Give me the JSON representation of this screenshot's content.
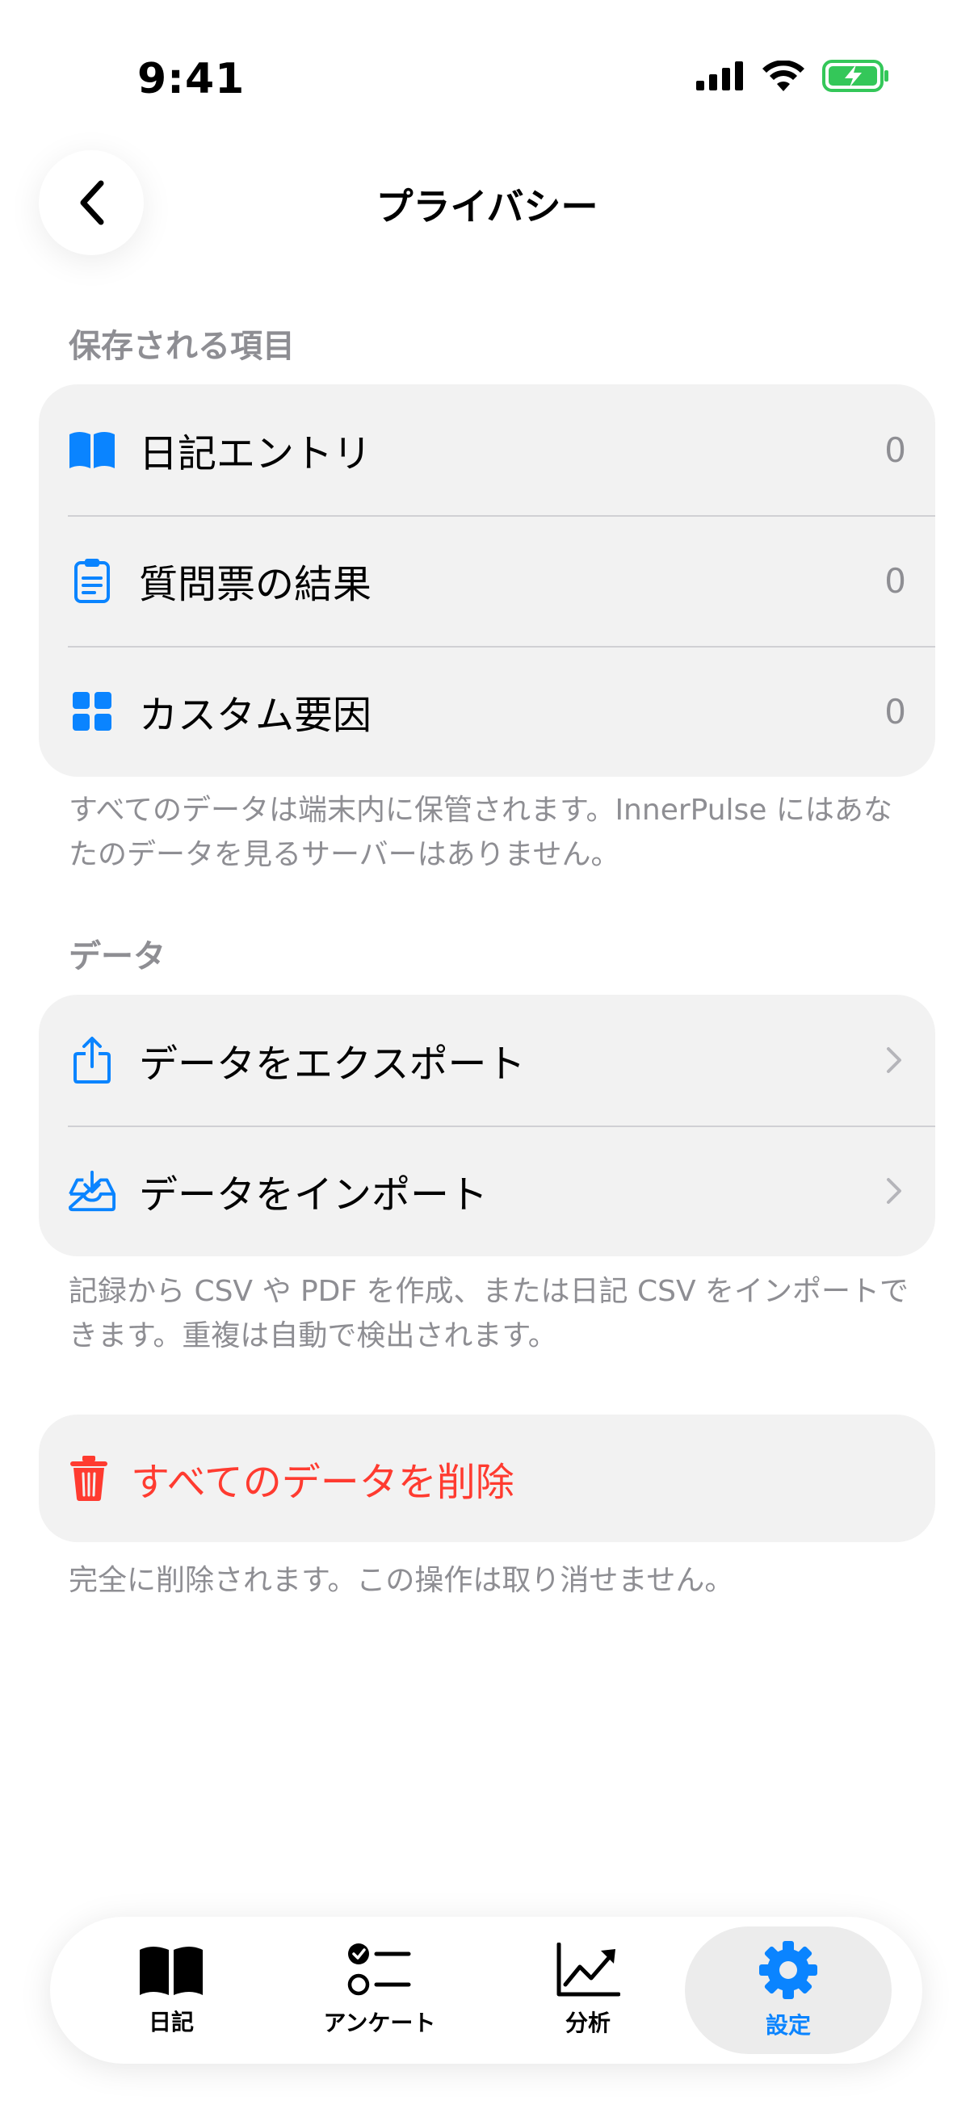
{
  "status": {
    "time": "9:41"
  },
  "nav": {
    "title": "プライバシー"
  },
  "stored": {
    "header": "保存される項目",
    "items": [
      {
        "label": "日記エントリ",
        "value": "0",
        "icon": "book-icon"
      },
      {
        "label": "質問票の結果",
        "value": "0",
        "icon": "clipboard-icon"
      },
      {
        "label": "カスタム要因",
        "value": "0",
        "icon": "grid-icon"
      }
    ],
    "footnote": "すべてのデータは端末内に保管されます。InnerPulse にはあなたのデータを見るサーバーはありません。"
  },
  "data": {
    "header": "データ",
    "items": [
      {
        "label": "データをエクスポート",
        "icon": "share-icon"
      },
      {
        "label": "データをインポート",
        "icon": "tray-download-icon"
      }
    ],
    "footnote": "記録から CSV や PDF を作成、または日記 CSV をインポートできます。重複は自動で検出されます。"
  },
  "delete": {
    "label": "すべてのデータを削除",
    "footnote": "完全に削除されます。この操作は取り消せません。"
  },
  "tabs": [
    {
      "label": "日記",
      "icon": "book-icon"
    },
    {
      "label": "アンケート",
      "icon": "checklist-icon"
    },
    {
      "label": "分析",
      "icon": "chart-icon"
    },
    {
      "label": "設定",
      "icon": "gear-icon",
      "active": true
    }
  ],
  "colors": {
    "accent": "#0a84ff",
    "destructive": "#ff3b30",
    "battery": "#34c759"
  }
}
